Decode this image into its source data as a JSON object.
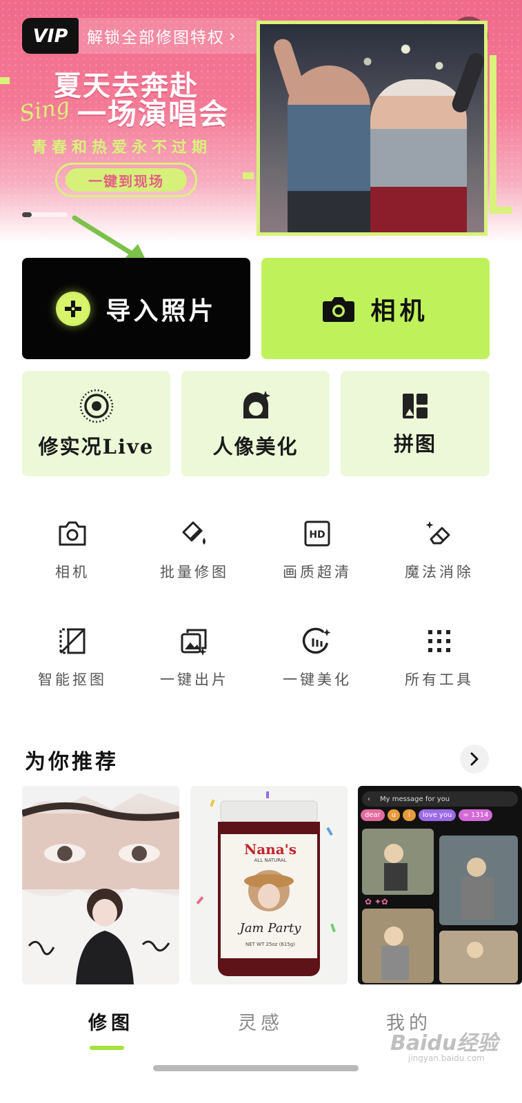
{
  "banner": {
    "vip_badge": "VIP",
    "vip_text": "解锁全部修图特权",
    "vip_chevron": "›",
    "slogan_line1": "夏天去奔赴",
    "slogan_sing": "Sing",
    "slogan_line2": "一场演唱会",
    "slogan_line3": "青春和热爱永不过期",
    "cta_label": "一键到现场",
    "search_icon": "search-icon",
    "page_indicator": {
      "current": 1
    }
  },
  "primary_actions": {
    "import_label": "导入照片",
    "camera_label": "相机"
  },
  "feature_tiles": [
    {
      "label": "修实况Live",
      "icon": "live-photo-icon"
    },
    {
      "label": "人像美化",
      "icon": "portrait-icon"
    },
    {
      "label": "拼图",
      "icon": "collage-icon"
    }
  ],
  "tools": [
    {
      "label": "相机",
      "icon": "camera-outline-icon"
    },
    {
      "label": "批量修图",
      "icon": "batch-edit-icon"
    },
    {
      "label": "画质超清",
      "icon": "hd-icon"
    },
    {
      "label": "魔法消除",
      "icon": "eraser-icon"
    },
    {
      "label": "智能抠图",
      "icon": "cutout-icon"
    },
    {
      "label": "一键出片",
      "icon": "one-tap-output-icon"
    },
    {
      "label": "一键美化",
      "icon": "auto-beautify-icon"
    },
    {
      "label": "所有工具",
      "icon": "all-tools-icon"
    }
  ],
  "recommend": {
    "title": "为你推荐",
    "cards": [
      {
        "caption": ""
      },
      {
        "brand": "Nana's",
        "tagline": "ALL NATURAL",
        "script": "Jam Party",
        "net_wt": "NET WT 25oz (615g)"
      },
      {
        "header": "My message for you",
        "chips": [
          "dear",
          "u",
          "i",
          "love you",
          "= 1314"
        ]
      }
    ]
  },
  "nav": {
    "items": [
      "修图",
      "灵感",
      "我的"
    ],
    "active_index": 0,
    "accent_color": "#a6e23a"
  },
  "watermark": {
    "text": "Baidu经验",
    "sub": "jingyan.baidu.com"
  },
  "colors": {
    "lime": "#bff25a",
    "tile_bg": "#ecf8d7",
    "banner_pink": "#f06a8a"
  }
}
